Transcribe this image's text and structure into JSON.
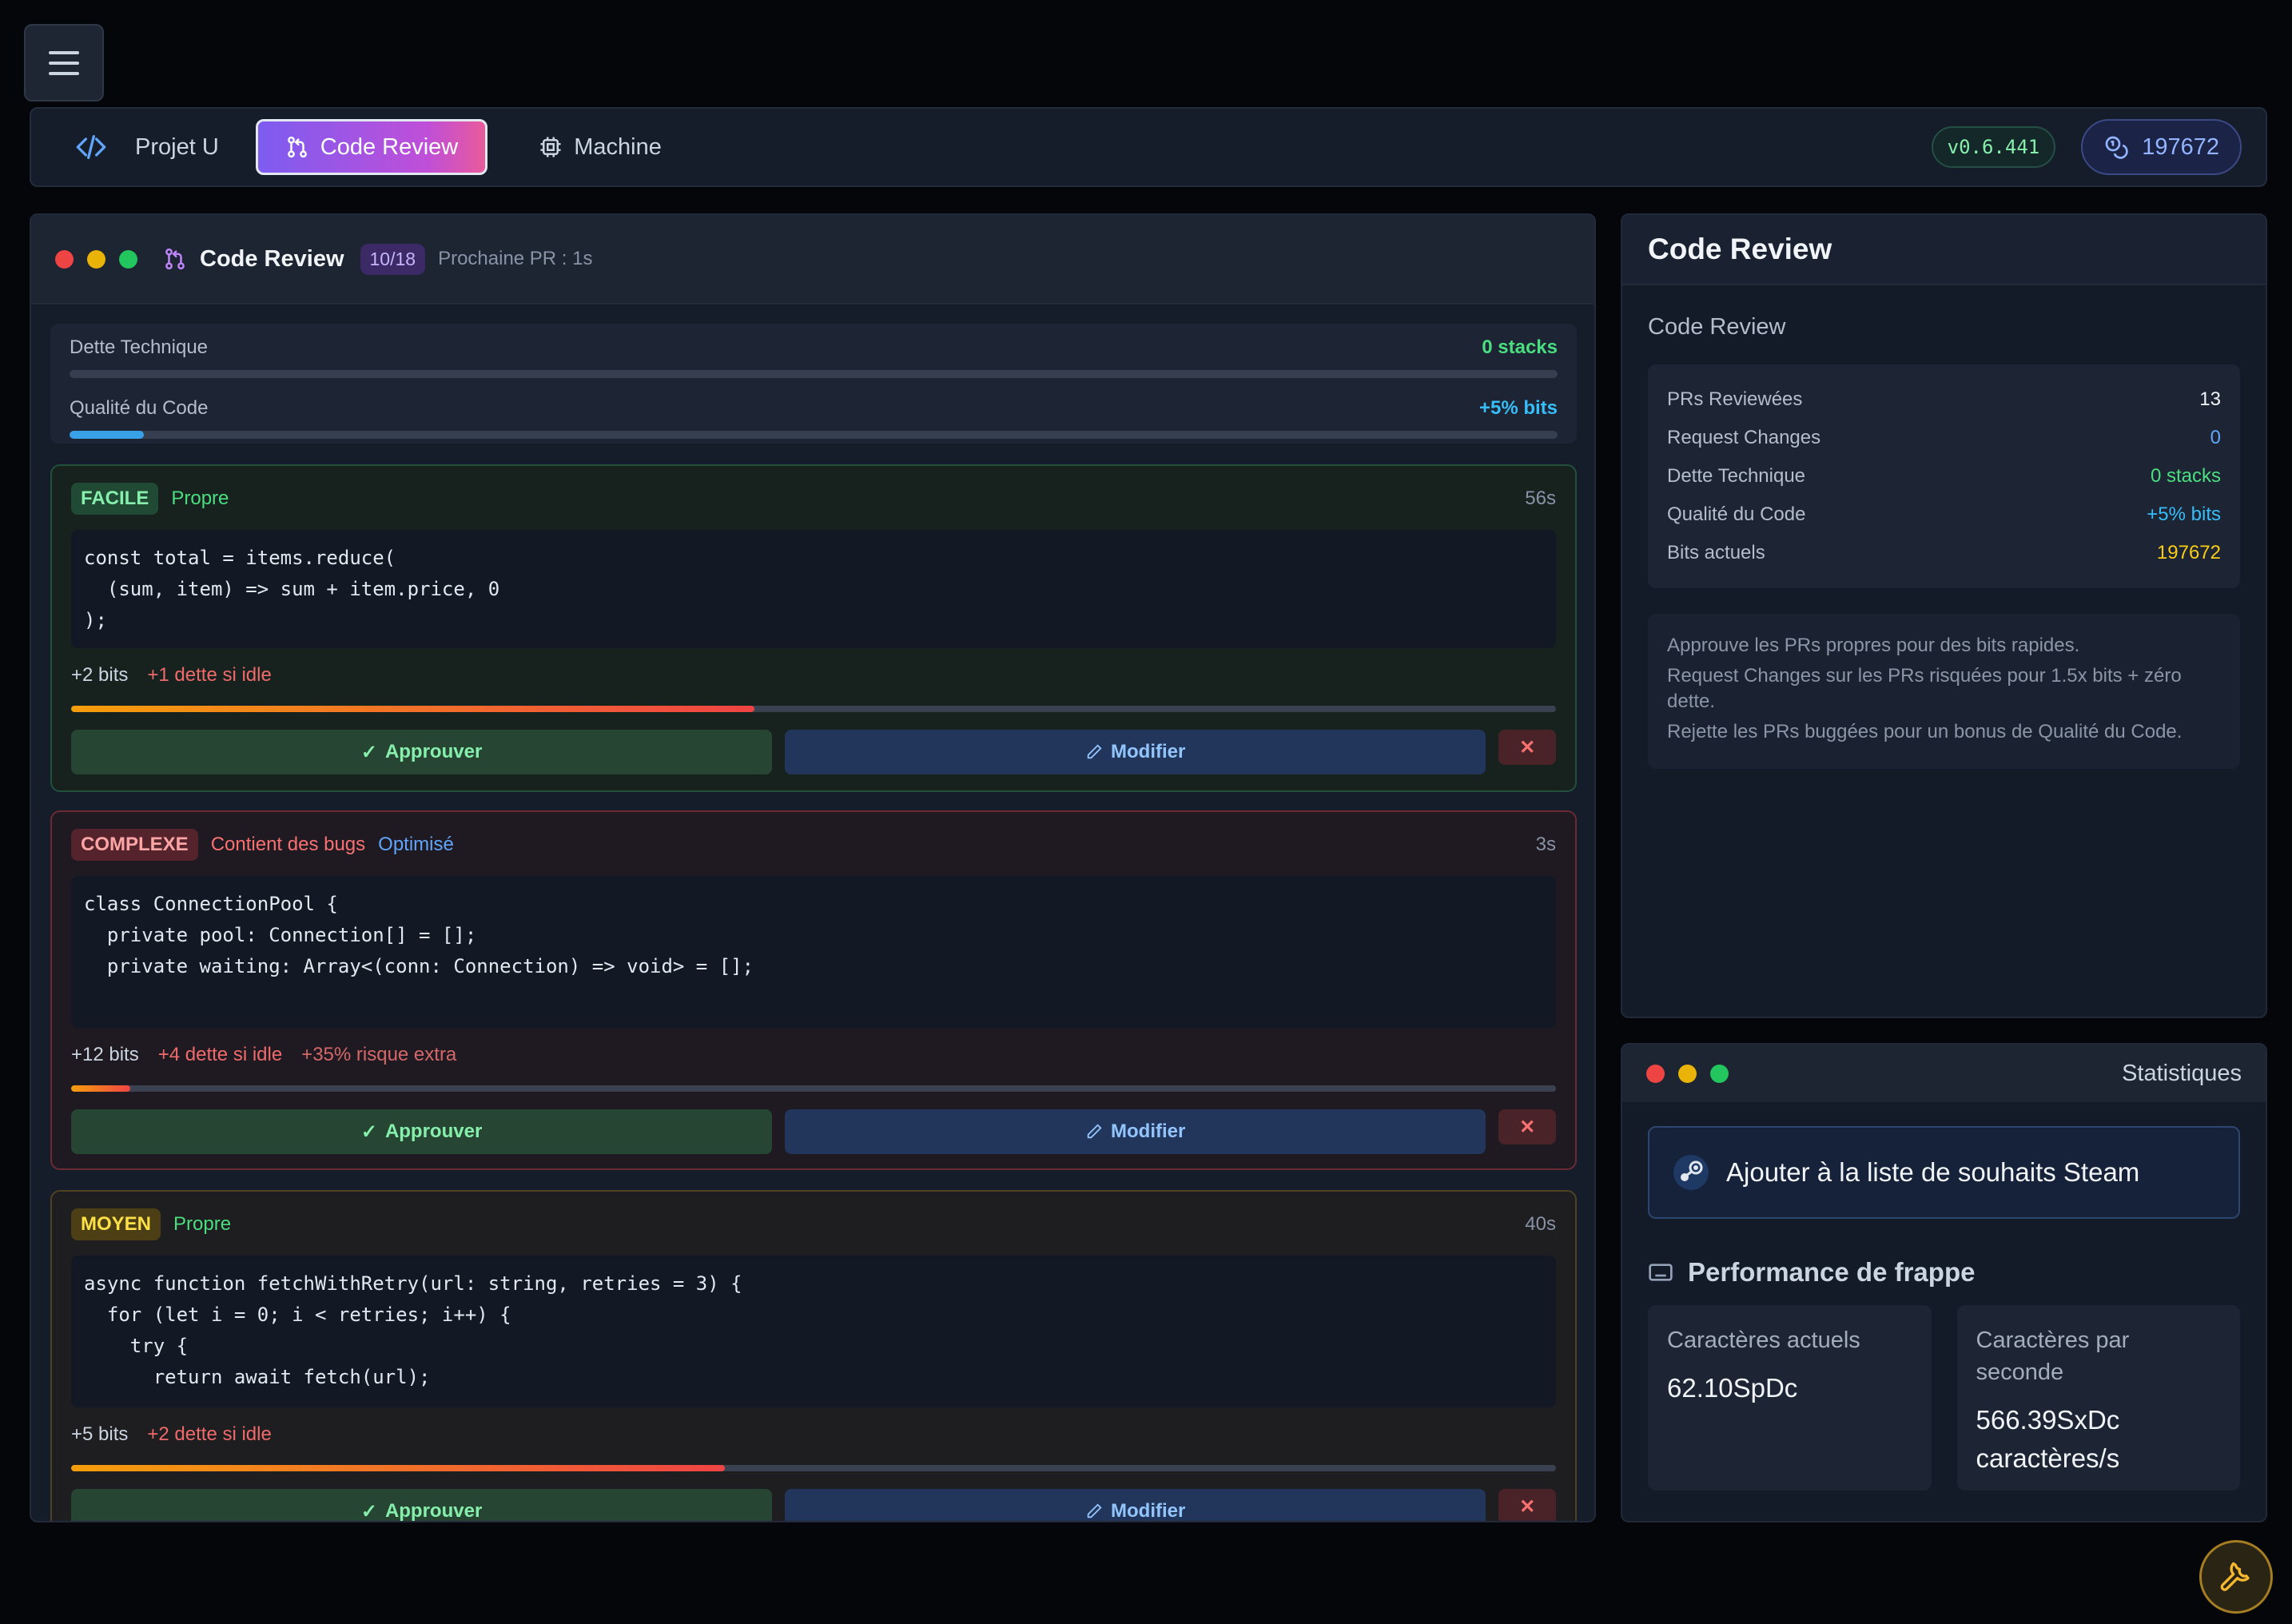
{
  "topbar": {
    "project_label": "Projet U",
    "tab_code_review": "Code Review",
    "tab_machine": "Machine",
    "version": "v0.6.441",
    "bits": "197672"
  },
  "review_window": {
    "title": "Code Review",
    "count": "10/18",
    "next_pr": "Prochaine PR : 1s",
    "meters": {
      "debt_label": "Dette Technique",
      "debt_value": "0 stacks",
      "debt_fill": 0,
      "quality_label": "Qualité du Code",
      "quality_value": "+5% bits",
      "quality_fill": 0.05
    },
    "prs": [
      {
        "difficulty": "FACILE",
        "labels": [
          "Propre"
        ],
        "time": "56s",
        "code": "const total = items.reduce(\n  (sum, item) => sum + item.price, 0\n);",
        "reward": "+2 bits",
        "extras": [
          "+1 dette si idle"
        ],
        "timer_fill": 0.46
      },
      {
        "difficulty": "COMPLEXE",
        "labels": [
          "Contient des bugs",
          "Optimisé"
        ],
        "time": "3s",
        "code": "class ConnectionPool {\n  private pool: Connection[] = [];\n  private waiting: Array<(conn: Connection) => void> = [];",
        "reward": "+12 bits",
        "extras": [
          "+4 dette si idle",
          "+35% risque extra"
        ],
        "timer_fill": 0.04
      },
      {
        "difficulty": "MOYEN",
        "labels": [
          "Propre"
        ],
        "time": "40s",
        "code": "async function fetchWithRetry(url: string, retries = 3) {\n  for (let i = 0; i < retries; i++) {\n    try {\n      return await fetch(url);",
        "reward": "+5 bits",
        "extras": [
          "+2 dette si idle"
        ],
        "timer_fill": 0.44
      }
    ],
    "approve_label": "Approuver",
    "modify_label": "Modifier",
    "reject_label": "✕"
  },
  "side_panel": {
    "title": "Code Review",
    "subtitle": "Code Review",
    "stats": [
      {
        "label": "PRs Reviewées",
        "value": "13"
      },
      {
        "label": "Request Changes",
        "value": "0"
      },
      {
        "label": "Dette Technique",
        "value": "0 stacks"
      },
      {
        "label": "Qualité du Code",
        "value": "+5% bits"
      },
      {
        "label": "Bits actuels",
        "value": "197672"
      }
    ],
    "help": [
      "Approuve les PRs propres pour des bits rapides.",
      "Request Changes sur les PRs risquées pour 1.5x bits + zéro dette.",
      "Rejette les PRs buggées pour un bonus de Qualité du Code."
    ]
  },
  "stats_window": {
    "title": "Statistiques",
    "steam_label": "Ajouter à la liste de souhaits Steam",
    "perf_title": "Performance de frappe",
    "current_chars_label": "Caractères actuels",
    "current_chars_value": "62.10SpDc",
    "cps_label": "Caractères par seconde",
    "cps_value": "566.39SxDc caractères/s"
  },
  "colors": {
    "accent_purple": "#7c5cf0",
    "accent_pink": "#e85a9a",
    "success": "#4ade80",
    "danger": "#f87171",
    "warning": "#facc15",
    "info": "#60a5fa"
  },
  "icons": {
    "menu": "hamburger-icon",
    "code": "code-brackets-icon",
    "pull_request": "git-pull-request-icon",
    "machine": "cpu-chip-icon",
    "coins": "coins-icon",
    "check": "check-icon",
    "pencil": "pencil-icon",
    "close": "close-icon",
    "steam": "steam-icon",
    "keyboard": "keyboard-icon",
    "wrench": "wrench-icon"
  }
}
